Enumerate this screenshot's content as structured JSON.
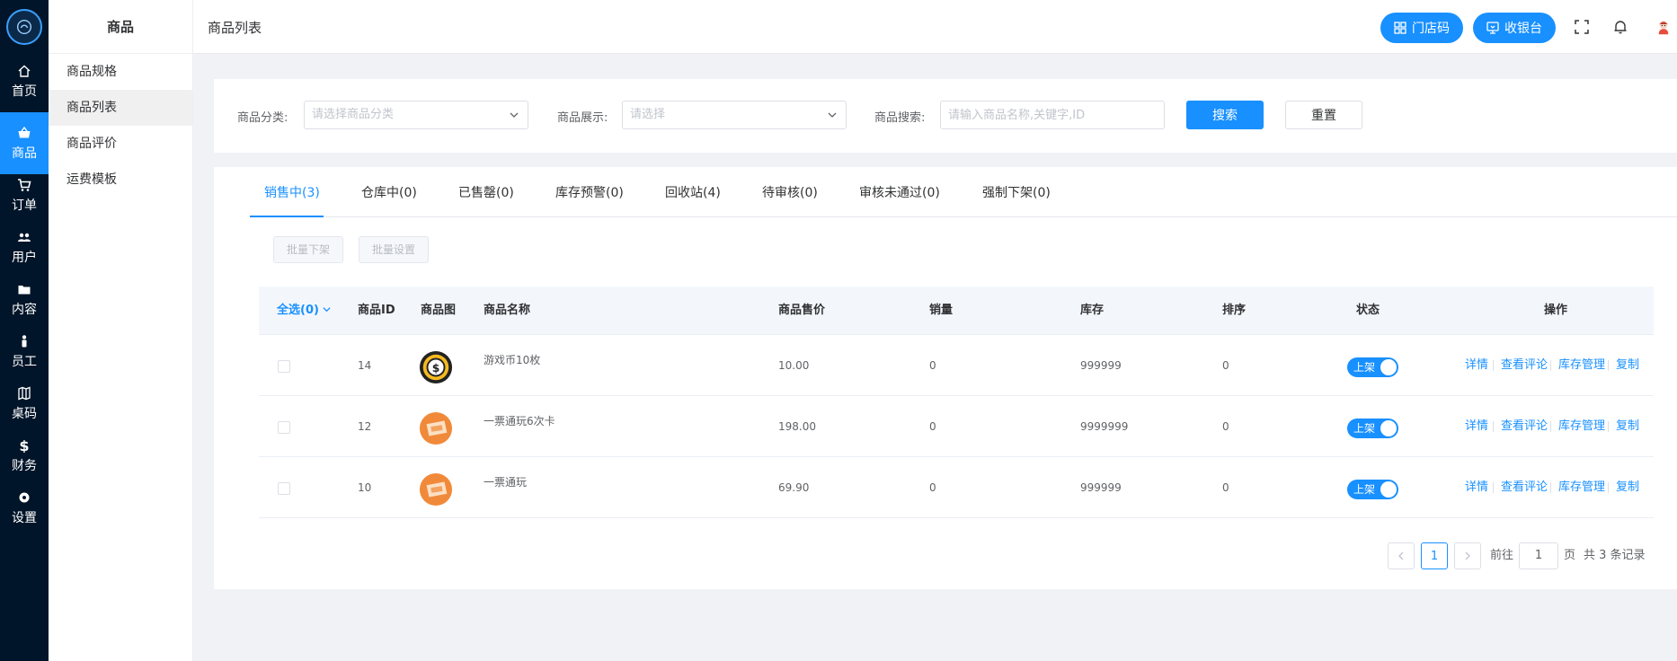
{
  "rail": {
    "items": [
      {
        "label": "首页",
        "icon": "home-icon"
      },
      {
        "label": "商品",
        "icon": "shop-basket-icon"
      },
      {
        "label": "订单",
        "icon": "cart-icon"
      },
      {
        "label": "用户",
        "icon": "users-icon"
      },
      {
        "label": "内容",
        "icon": "folder-icon"
      },
      {
        "label": "员工",
        "icon": "staff-icon"
      },
      {
        "label": "桌码",
        "icon": "map-icon"
      },
      {
        "label": "财务",
        "icon": "dollar-icon"
      },
      {
        "label": "设置",
        "icon": "gear-icon"
      }
    ],
    "active": "商品"
  },
  "subside": {
    "title": "商品",
    "items": [
      "商品规格",
      "商品列表",
      "商品评价",
      "运费模板"
    ],
    "active": "商品列表"
  },
  "header": {
    "title": "商品列表",
    "store_code_label": "门店码",
    "cashier_label": "收银台"
  },
  "filter": {
    "category_label": "商品分类:",
    "category_placeholder": "请选择商品分类",
    "display_label": "商品展示:",
    "display_placeholder": "请选择",
    "search_label": "商品搜索:",
    "search_placeholder": "请输入商品名称,关键字,ID",
    "search_button": "搜索",
    "reset_button": "重置"
  },
  "tabs": [
    "销售中(3)",
    "仓库中(0)",
    "已售罄(0)",
    "库存预警(0)",
    "回收站(4)",
    "待审核(0)",
    "审核未通过(0)",
    "强制下架(0)"
  ],
  "batch": {
    "offline": "批量下架",
    "settings": "批量设置"
  },
  "table": {
    "headers": {
      "select_all": "全选(0)",
      "id": "商品ID",
      "image": "商品图",
      "name": "商品名称",
      "price": "商品售价",
      "sales": "销量",
      "stock": "库存",
      "sort": "排序",
      "status": "状态",
      "actions": "操作"
    },
    "rows": [
      {
        "id": "14",
        "name": "游戏币10枚",
        "price": "10.00",
        "sales": "0",
        "stock": "999999",
        "sort": "0",
        "status": "上架",
        "thumb": "coin"
      },
      {
        "id": "12",
        "name": "一票通玩6次卡",
        "price": "198.00",
        "sales": "0",
        "stock": "9999999",
        "sort": "0",
        "status": "上架",
        "thumb": "ticket"
      },
      {
        "id": "10",
        "name": "一票通玩",
        "price": "69.90",
        "sales": "0",
        "stock": "999999",
        "sort": "0",
        "status": "上架",
        "thumb": "ticket"
      }
    ],
    "actions": {
      "detail": "详情",
      "reviews": "查看评论",
      "stock": "库存管理",
      "copy": "复制"
    }
  },
  "pagination": {
    "current": "1",
    "goto_label": "前往",
    "goto_value": "1",
    "page_label": "页",
    "total": "共 3 条记录"
  },
  "colors": {
    "primary": "#1890ff",
    "rail": "#001529"
  }
}
